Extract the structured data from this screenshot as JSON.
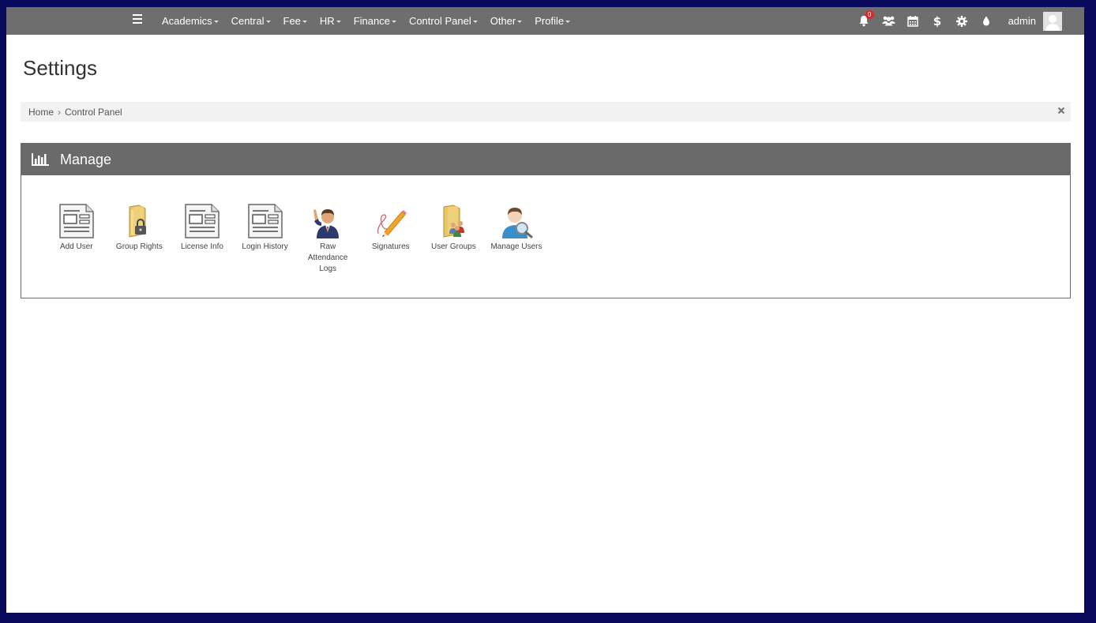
{
  "navbar": {
    "menu": [
      {
        "label": "Academics"
      },
      {
        "label": "Central"
      },
      {
        "label": "Fee"
      },
      {
        "label": "HR"
      },
      {
        "label": "Finance"
      },
      {
        "label": "Control Panel"
      },
      {
        "label": "Other"
      },
      {
        "label": "Profile"
      }
    ],
    "notification_count": "0",
    "username": "admin"
  },
  "page": {
    "title": "Settings",
    "breadcrumb": [
      "Home",
      "Control Panel"
    ]
  },
  "panel": {
    "title": "Manage",
    "tiles": [
      {
        "label": "Add User",
        "icon": "document-form-icon"
      },
      {
        "label": "Group Rights",
        "icon": "locked-folder-icon"
      },
      {
        "label": "License Info",
        "icon": "document-form-icon"
      },
      {
        "label": "Login History",
        "icon": "document-form-icon"
      },
      {
        "label": "Raw Attendance Logs",
        "icon": "raised-hand-person-icon"
      },
      {
        "label": "Signatures",
        "icon": "pencil-signature-icon"
      },
      {
        "label": "User Groups",
        "icon": "group-folder-icon"
      },
      {
        "label": "Manage Users",
        "icon": "user-search-icon"
      }
    ]
  },
  "colors": {
    "navbar": "#6e6e6e",
    "panel_header": "#6a6a6a",
    "badge": "#d9272e",
    "frame": "#0a0a5c"
  }
}
